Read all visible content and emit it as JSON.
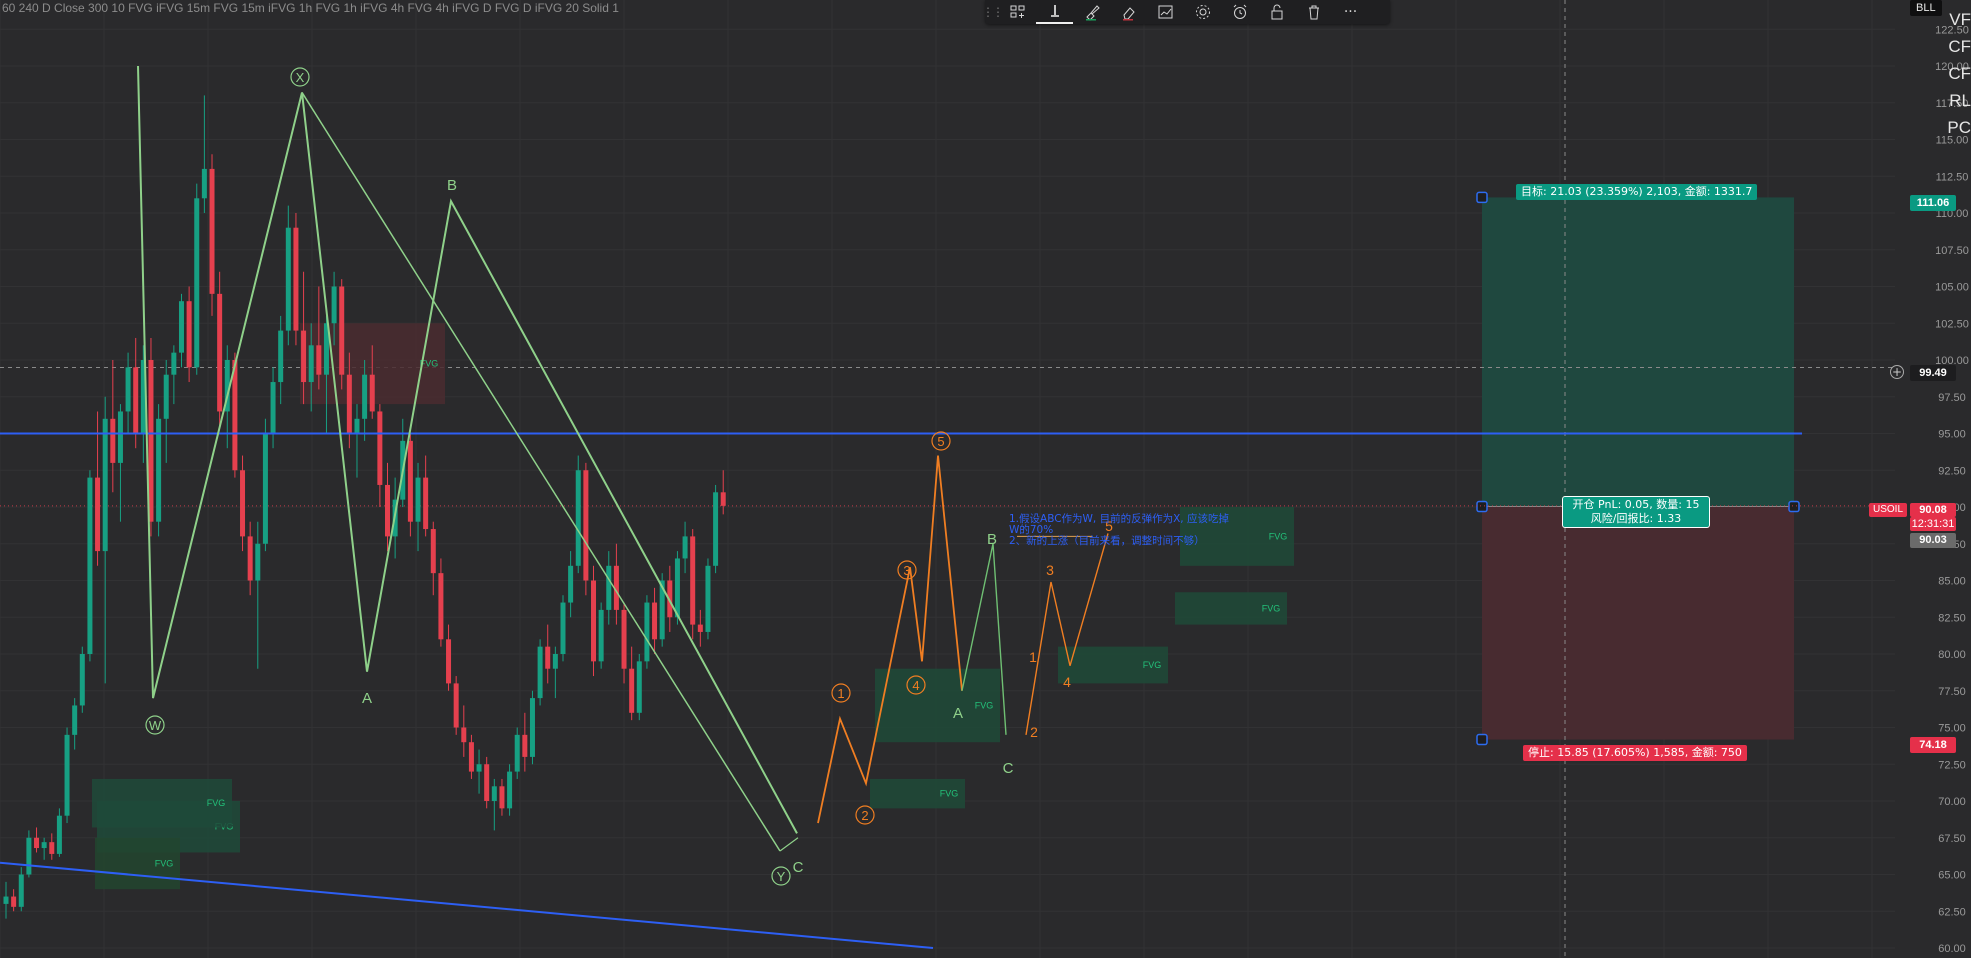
{
  "study_legend": "60 240 D Close 300 10 FVG iFVG 15m FVG 15m iFVG 1h FVG 1h iFVG 4h FVG 4h iFVG D FVG D iFVG 20 Solid 1",
  "toolbar": {
    "items": [
      {
        "name": "drag-handle",
        "label": "⋮⋮"
      },
      {
        "name": "object-tree-icon",
        "label": "object tree"
      },
      {
        "name": "line-tool-icon",
        "label": "line"
      },
      {
        "name": "brush-icon",
        "label": "brush"
      },
      {
        "name": "eraser-icon",
        "label": "eraser"
      },
      {
        "name": "trend-chart-icon",
        "label": "chart"
      },
      {
        "name": "settings-gear-icon",
        "label": "settings"
      },
      {
        "name": "alarm-icon",
        "label": "alert"
      },
      {
        "name": "lock-icon",
        "label": "lock"
      },
      {
        "name": "trash-icon",
        "label": "trash"
      },
      {
        "name": "more-icon",
        "label": "···"
      }
    ]
  },
  "symbol_badge": "BLL",
  "watchlist_fragments": [
    "VF",
    "CF",
    "CF",
    "RL",
    "PC"
  ],
  "price_axis": {
    "ticks": [
      "122.50",
      "120.00",
      "117.50",
      "115.00",
      "112.50",
      "110.00",
      "107.50",
      "105.00",
      "102.50",
      "100.00",
      "97.50",
      "95.00",
      "92.50",
      "90.00",
      "87.50",
      "85.00",
      "82.50",
      "80.00",
      "77.50",
      "75.00",
      "72.50",
      "70.00",
      "67.50",
      "65.00",
      "62.50",
      "60.00"
    ],
    "tag_target": "111.06",
    "tag_crosshair": "99.49",
    "tag_last": "90.08",
    "tag_countdown": "12:31:31",
    "tag_entry": "90.03",
    "tag_stop": "74.18"
  },
  "position": {
    "target_label": "目标: 21.03 (23.359%) 2,103, 金额: 1331.7",
    "center_line1": "开仓 PnL: 0.05, 数量: 15",
    "center_line2": "风险/回报比: 1.33",
    "stop_label": "停止: 15.85 (17.605%) 1,585, 金额: 750",
    "colors": {
      "profit": "#1f4a40",
      "loss": "#4a2b30",
      "accent": "#0a9a82",
      "stop": "#e5304a"
    }
  },
  "symbol_tag": "USOIL",
  "annotation": {
    "line1": "1.假设ABC作为W, 目前的反弹作为X, 应该吃掉",
    "line2": "W的70%",
    "line3": "2、新的上涨（目前来看，调整时间不够）"
  },
  "wave_labels": {
    "X": "X",
    "W": "W",
    "Y": "Y",
    "A1": "A",
    "B1": "B",
    "C1": "C",
    "A2": "A",
    "B2": "B",
    "C2": "C",
    "w1": "1",
    "w2": "2",
    "w3": "3",
    "w4": "4",
    "w5": "5",
    "s1": "1",
    "s2": "2",
    "s3": "3",
    "s4": "4",
    "s5": "5"
  },
  "fvg_label": "FVG",
  "horizontal_line_price": 95.0,
  "last_price": 90.08,
  "candles": [
    [
      63.0,
      64.5,
      62.0,
      63.5
    ],
    [
      63.5,
      64.0,
      62.5,
      62.8
    ],
    [
      62.8,
      65.5,
      62.5,
      65.0
    ],
    [
      65.0,
      68.0,
      64.8,
      67.5
    ],
    [
      67.5,
      68.2,
      66.5,
      66.8
    ],
    [
      66.8,
      67.5,
      66.0,
      67.2
    ],
    [
      67.2,
      67.8,
      66.0,
      66.4
    ],
    [
      66.4,
      69.5,
      66.2,
      69.0
    ],
    [
      69.0,
      75.0,
      68.5,
      74.5
    ],
    [
      74.5,
      77.0,
      73.5,
      76.5
    ],
    [
      76.5,
      80.5,
      76.0,
      80.0
    ],
    [
      80.0,
      92.5,
      79.5,
      92.0
    ],
    [
      92.0,
      96.5,
      86.0,
      87.0
    ],
    [
      87.0,
      97.5,
      78.0,
      96.0
    ],
    [
      96.0,
      100.0,
      91.0,
      93.0
    ],
    [
      93.0,
      97.0,
      89.0,
      96.5
    ],
    [
      96.5,
      100.5,
      95.0,
      99.5
    ],
    [
      99.5,
      101.5,
      94.0,
      95.0
    ],
    [
      95.0,
      101.0,
      93.0,
      100.0
    ],
    [
      100.0,
      101.5,
      88.0,
      89.0
    ],
    [
      89.0,
      97.0,
      88.0,
      96.0
    ],
    [
      96.0,
      100.0,
      93.0,
      99.0
    ],
    [
      99.0,
      101.0,
      97.0,
      100.5
    ],
    [
      100.5,
      104.5,
      99.5,
      104.0
    ],
    [
      104.0,
      105.0,
      98.5,
      99.5
    ],
    [
      99.5,
      112.0,
      99.0,
      111.0
    ],
    [
      111.0,
      118.0,
      110.0,
      113.0
    ],
    [
      113.0,
      114.0,
      103.0,
      104.5
    ],
    [
      104.5,
      106.0,
      95.5,
      96.5
    ],
    [
      96.5,
      101.0,
      94.0,
      100.0
    ],
    [
      100.0,
      100.5,
      92.0,
      92.5
    ],
    [
      92.5,
      93.5,
      87.0,
      88.0
    ],
    [
      88.0,
      89.0,
      84.0,
      85.0
    ],
    [
      85.0,
      89.0,
      79.0,
      87.5
    ],
    [
      87.5,
      96.0,
      87.0,
      95.0
    ],
    [
      95.0,
      99.5,
      94.0,
      98.5
    ],
    [
      98.5,
      103.0,
      97.0,
      102.0
    ],
    [
      102.0,
      110.5,
      101.0,
      109.0
    ],
    [
      109.0,
      110.0,
      101.0,
      102.0
    ],
    [
      102.0,
      106.0,
      97.0,
      98.5
    ],
    [
      98.5,
      102.5,
      96.5,
      101.0
    ],
    [
      101.0,
      105.0,
      98.0,
      99.0
    ],
    [
      99.0,
      103.0,
      95.0,
      102.5
    ],
    [
      102.5,
      106.0,
      101.0,
      105.0
    ],
    [
      105.0,
      105.5,
      98.0,
      99.0
    ],
    [
      99.0,
      100.5,
      94.0,
      95.0
    ],
    [
      95.0,
      97.0,
      92.0,
      96.0
    ],
    [
      96.0,
      100.0,
      94.5,
      99.0
    ],
    [
      99.0,
      101.0,
      96.0,
      96.5
    ],
    [
      96.5,
      97.0,
      90.0,
      91.5
    ],
    [
      91.5,
      93.0,
      87.0,
      88.0
    ],
    [
      88.0,
      92.0,
      86.5,
      90.5
    ],
    [
      90.5,
      96.0,
      90.0,
      94.5
    ],
    [
      94.5,
      95.0,
      88.0,
      89.0
    ],
    [
      89.0,
      93.0,
      87.0,
      92.0
    ],
    [
      92.0,
      93.5,
      88.0,
      88.5
    ],
    [
      88.5,
      89.0,
      84.0,
      85.5
    ],
    [
      85.5,
      86.5,
      80.5,
      81.0
    ],
    [
      81.0,
      82.0,
      77.5,
      78.0
    ],
    [
      78.0,
      78.5,
      74.5,
      75.0
    ],
    [
      75.0,
      76.5,
      73.0,
      74.0
    ],
    [
      74.0,
      74.5,
      71.5,
      72.0
    ],
    [
      72.0,
      73.5,
      70.5,
      72.5
    ],
    [
      72.5,
      73.0,
      69.5,
      70.0
    ],
    [
      70.0,
      71.5,
      68.0,
      71.0
    ],
    [
      71.0,
      71.5,
      69.0,
      69.5
    ],
    [
      69.5,
      72.5,
      69.0,
      72.0
    ],
    [
      72.0,
      75.0,
      71.5,
      74.5
    ],
    [
      74.5,
      76.0,
      72.0,
      73.0
    ],
    [
      73.0,
      77.5,
      72.5,
      77.0
    ],
    [
      77.0,
      81.0,
      76.5,
      80.5
    ],
    [
      80.5,
      82.0,
      78.0,
      79.0
    ],
    [
      79.0,
      80.5,
      77.0,
      80.0
    ],
    [
      80.0,
      84.0,
      79.5,
      83.5
    ],
    [
      83.5,
      87.0,
      82.5,
      86.0
    ],
    [
      86.0,
      93.5,
      85.5,
      92.5
    ],
    [
      92.5,
      93.0,
      84.0,
      85.0
    ],
    [
      85.0,
      86.0,
      78.5,
      79.5
    ],
    [
      79.5,
      83.5,
      79.0,
      83.0
    ],
    [
      83.0,
      87.0,
      82.0,
      86.0
    ],
    [
      86.0,
      87.5,
      82.0,
      83.0
    ],
    [
      83.0,
      83.5,
      78.0,
      79.0
    ],
    [
      79.0,
      80.5,
      75.5,
      76.0
    ],
    [
      76.0,
      80.0,
      75.5,
      79.5
    ],
    [
      79.5,
      84.0,
      79.0,
      83.5
    ],
    [
      83.5,
      84.5,
      80.0,
      81.0
    ],
    [
      81.0,
      85.5,
      80.5,
      85.0
    ],
    [
      85.0,
      86.0,
      81.5,
      82.5
    ],
    [
      82.5,
      87.0,
      82.0,
      86.5
    ],
    [
      86.5,
      89.0,
      85.5,
      88.0
    ],
    [
      88.0,
      88.5,
      81.0,
      82.0
    ],
    [
      82.0,
      83.0,
      80.5,
      81.5
    ],
    [
      81.5,
      86.5,
      81.0,
      86.0
    ],
    [
      86.0,
      91.5,
      85.5,
      91.0
    ],
    [
      91.0,
      92.5,
      89.5,
      90.08
    ]
  ]
}
